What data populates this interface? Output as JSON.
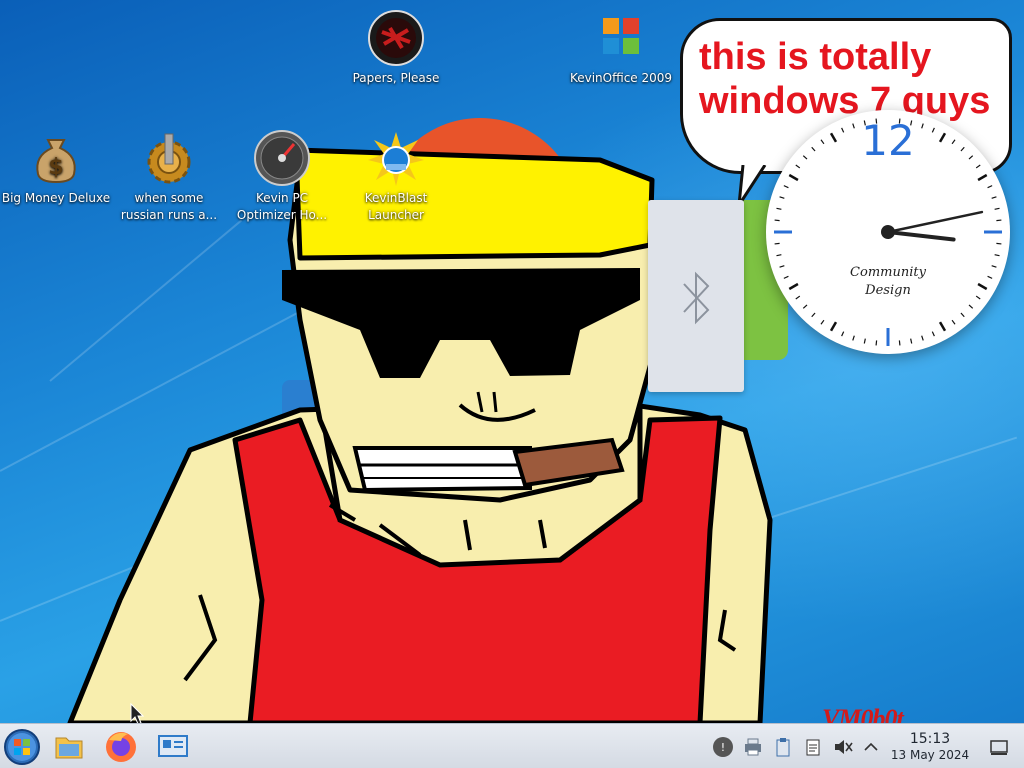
{
  "desktop": {
    "icons": [
      {
        "label": "Papers, Please"
      },
      {
        "label": "KevinOffice 2009"
      },
      {
        "label": "Big Money Deluxe"
      },
      {
        "label": "when some russian runs a..."
      },
      {
        "label": "Kevin PC Optimizer Ho..."
      },
      {
        "label": "KevinBlast Launcher"
      }
    ]
  },
  "speech_bubble": {
    "text": "this is totally windows 7 guys"
  },
  "clock_widget": {
    "numeral_12": "12",
    "brand_line1": "Community",
    "brand_line2": "Design"
  },
  "bluetooth_panel": {
    "icon": "bluetooth-icon"
  },
  "signature": {
    "text": "VM0b0t"
  },
  "taskbar": {
    "start_icon": "start-orb-icon",
    "pinned": [
      {
        "icon": "file-manager-icon"
      },
      {
        "icon": "firefox-icon"
      },
      {
        "icon": "system-settings-icon"
      }
    ],
    "tray": [
      {
        "icon": "updates-icon"
      },
      {
        "icon": "printer-icon"
      },
      {
        "icon": "clipboard-icon"
      },
      {
        "icon": "notes-icon"
      },
      {
        "icon": "volume-muted-icon"
      },
      {
        "icon": "show-hidden-icons-chevron"
      }
    ],
    "time": "15:13",
    "date": "13 May 2024",
    "show_desktop_icon": "show-desktop-icon"
  },
  "colors": {
    "wallpaper_blue": "#1b86d6",
    "speech_text_red": "#e5161f",
    "clock_accent_blue": "#2a6fd6",
    "taskbar_bg": "#e8ecf2"
  }
}
